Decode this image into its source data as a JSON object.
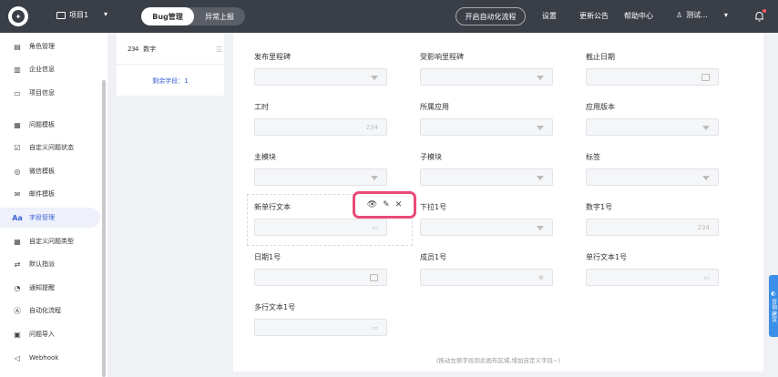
{
  "topbar": {
    "project": "项目1",
    "tabs": [
      "Bug管理",
      "异常上报"
    ],
    "auto_flow": "开启自动化流程",
    "links": [
      "设置",
      "更新公告",
      "帮助中心"
    ],
    "user": "测试..."
  },
  "sidebar": {
    "items": [
      {
        "label": "角色管理",
        "icon": "id-card-icon"
      },
      {
        "label": "企业信息",
        "icon": "building-icon"
      },
      {
        "label": "项目信息",
        "icon": "folder-icon"
      },
      {
        "label": "问题模板",
        "icon": "template-icon"
      },
      {
        "label": "自定义问题状态",
        "icon": "checklist-icon"
      },
      {
        "label": "微信模板",
        "icon": "wechat-icon"
      },
      {
        "label": "邮件模板",
        "icon": "mail-icon"
      },
      {
        "label": "字段管理",
        "icon": "text-field-icon",
        "active": true
      },
      {
        "label": "自定义问题类型",
        "icon": "grid-icon"
      },
      {
        "label": "默认指派",
        "icon": "assign-icon"
      },
      {
        "label": "通知提醒",
        "icon": "bell-outline-icon"
      },
      {
        "label": "自动化流程",
        "icon": "automation-icon"
      },
      {
        "label": "问题导入",
        "icon": "import-icon"
      },
      {
        "label": "Webhook",
        "icon": "webhook-icon"
      }
    ]
  },
  "middle": {
    "field_icon": "234",
    "field_label": "数字",
    "remaining": "剩余字段：1"
  },
  "canvas": {
    "fields": [
      {
        "label": "发布里程碑",
        "kind": "select"
      },
      {
        "label": "受影响里程碑",
        "kind": "select"
      },
      {
        "label": "截止日期",
        "kind": "date"
      },
      {
        "label": "工时",
        "kind": "number",
        "indicator": "234"
      },
      {
        "label": "所属应用",
        "kind": "select"
      },
      {
        "label": "应用版本",
        "kind": "select"
      },
      {
        "label": "主模块",
        "kind": "select"
      },
      {
        "label": "子模块",
        "kind": "select"
      },
      {
        "label": "标签",
        "kind": "select"
      },
      {
        "label": "新单行文本",
        "kind": "text"
      },
      {
        "label": "下拉1号",
        "kind": "select"
      },
      {
        "label": "数字1号",
        "kind": "number",
        "indicator": "234"
      },
      {
        "label": "日期1号",
        "kind": "date"
      },
      {
        "label": "成员1号",
        "kind": "member"
      },
      {
        "label": "单行文本1号",
        "kind": "text"
      },
      {
        "label": "多行文本1号",
        "kind": "textarea"
      }
    ],
    "hint": "(拖动左侧字段到此画布区域,增加自定义字段~)"
  },
  "feedback": "咨询·建议"
}
